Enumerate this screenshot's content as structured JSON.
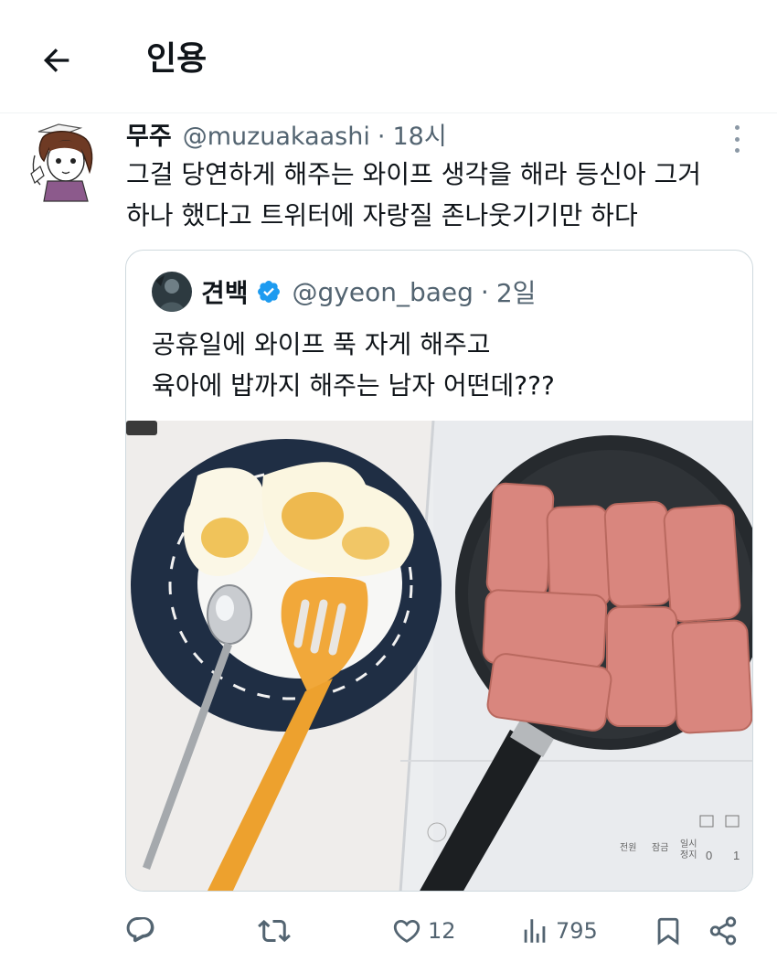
{
  "header": {
    "title": "인용",
    "back_icon": "arrow-left-icon"
  },
  "tweet": {
    "author_name": "무주",
    "author_handle": "@muzuakaashi",
    "separator": "·",
    "time": "18시",
    "text_lines": [
      "그걸 당연하게 해주는 와이프 생각을 해라 등신아 그거",
      "하나 했다고 트위터에 자랑질 존나웃기기만 하다"
    ]
  },
  "quoted": {
    "author_name": "견백",
    "verified": true,
    "author_handle": "@gyeon_baeg",
    "separator": "·",
    "time": "2일",
    "text_lines": [
      "공휴일에 와이프 푹 자게 해주고",
      "육아에 밥까지 해주는 남자 어떤데???"
    ],
    "photo": {
      "description_icons": [
        "plate-icon",
        "frying-pan-icon",
        "spatula-icon",
        "spoon-icon"
      ],
      "stove_labels": [
        "전원",
        "잠금",
        "일시 정지",
        "0",
        "1"
      ]
    }
  },
  "actions": {
    "reply": {
      "icon": "reply-icon",
      "count": ""
    },
    "retweet": {
      "icon": "retweet-icon",
      "count": ""
    },
    "like": {
      "icon": "heart-icon",
      "count": "12"
    },
    "views": {
      "icon": "views-icon",
      "count": "795"
    },
    "bookmark": {
      "icon": "bookmark-icon"
    },
    "share": {
      "icon": "share-icon"
    }
  },
  "colors": {
    "text_primary": "#0f1419",
    "text_secondary": "#536471",
    "verified_blue": "#1d9bf0",
    "border": "#cfd9de"
  }
}
